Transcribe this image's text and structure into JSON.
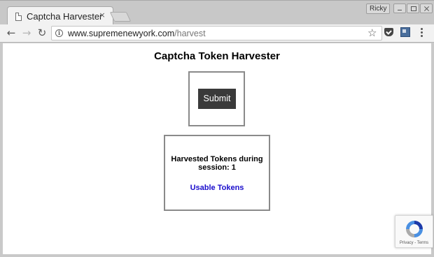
{
  "browser": {
    "tab_title": "Captcha Harvester",
    "tab_close": "×",
    "user_name": "Ricky",
    "url_host": "www.supremenewyork.com",
    "url_path": "/harvest",
    "icons": [
      "doc-icon",
      "close-icon",
      "back-arrow-icon",
      "forward-arrow-icon",
      "reload-icon",
      "info-icon",
      "star-icon",
      "pocket-icon",
      "extension-icon",
      "menu-icon"
    ]
  },
  "page": {
    "title": "Captcha Token Harvester",
    "submit_label": "Submit",
    "tokens_text": "Harvested Tokens during session: 1",
    "usable_link": "Usable Tokens",
    "recaptcha_terms": "Privacy - Terms"
  },
  "colors": {
    "submit_bg": "#3a3a3a",
    "link": "#1a0dcc"
  }
}
